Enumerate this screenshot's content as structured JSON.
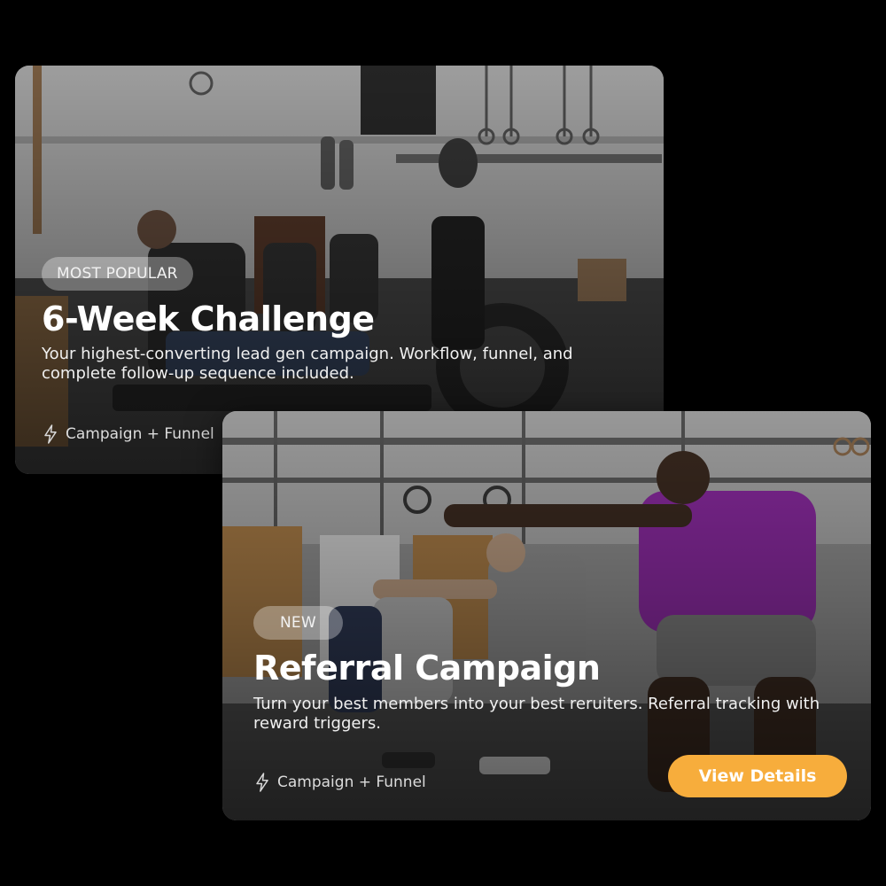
{
  "cards": [
    {
      "badge": "MOST POPULAR",
      "title": "6-Week Challenge",
      "description": "Your highest-converting lead gen campaign. Workflow, funnel, and complete follow-up sequence included.",
      "meta_icon": "lightning-bolt-icon",
      "meta": "Campaign + Funnel"
    },
    {
      "badge": "NEW",
      "title": "Referral Campaign",
      "description": "Turn your best members into your best reruiters. Referral tracking with reward triggers.",
      "meta_icon": "lightning-bolt-icon",
      "meta": "Campaign + Funnel",
      "button": "View Details"
    }
  ],
  "colors": {
    "background": "#000000",
    "accent": "#f7ad3c",
    "badge_bg": "rgba(255,255,255,0.32)"
  }
}
